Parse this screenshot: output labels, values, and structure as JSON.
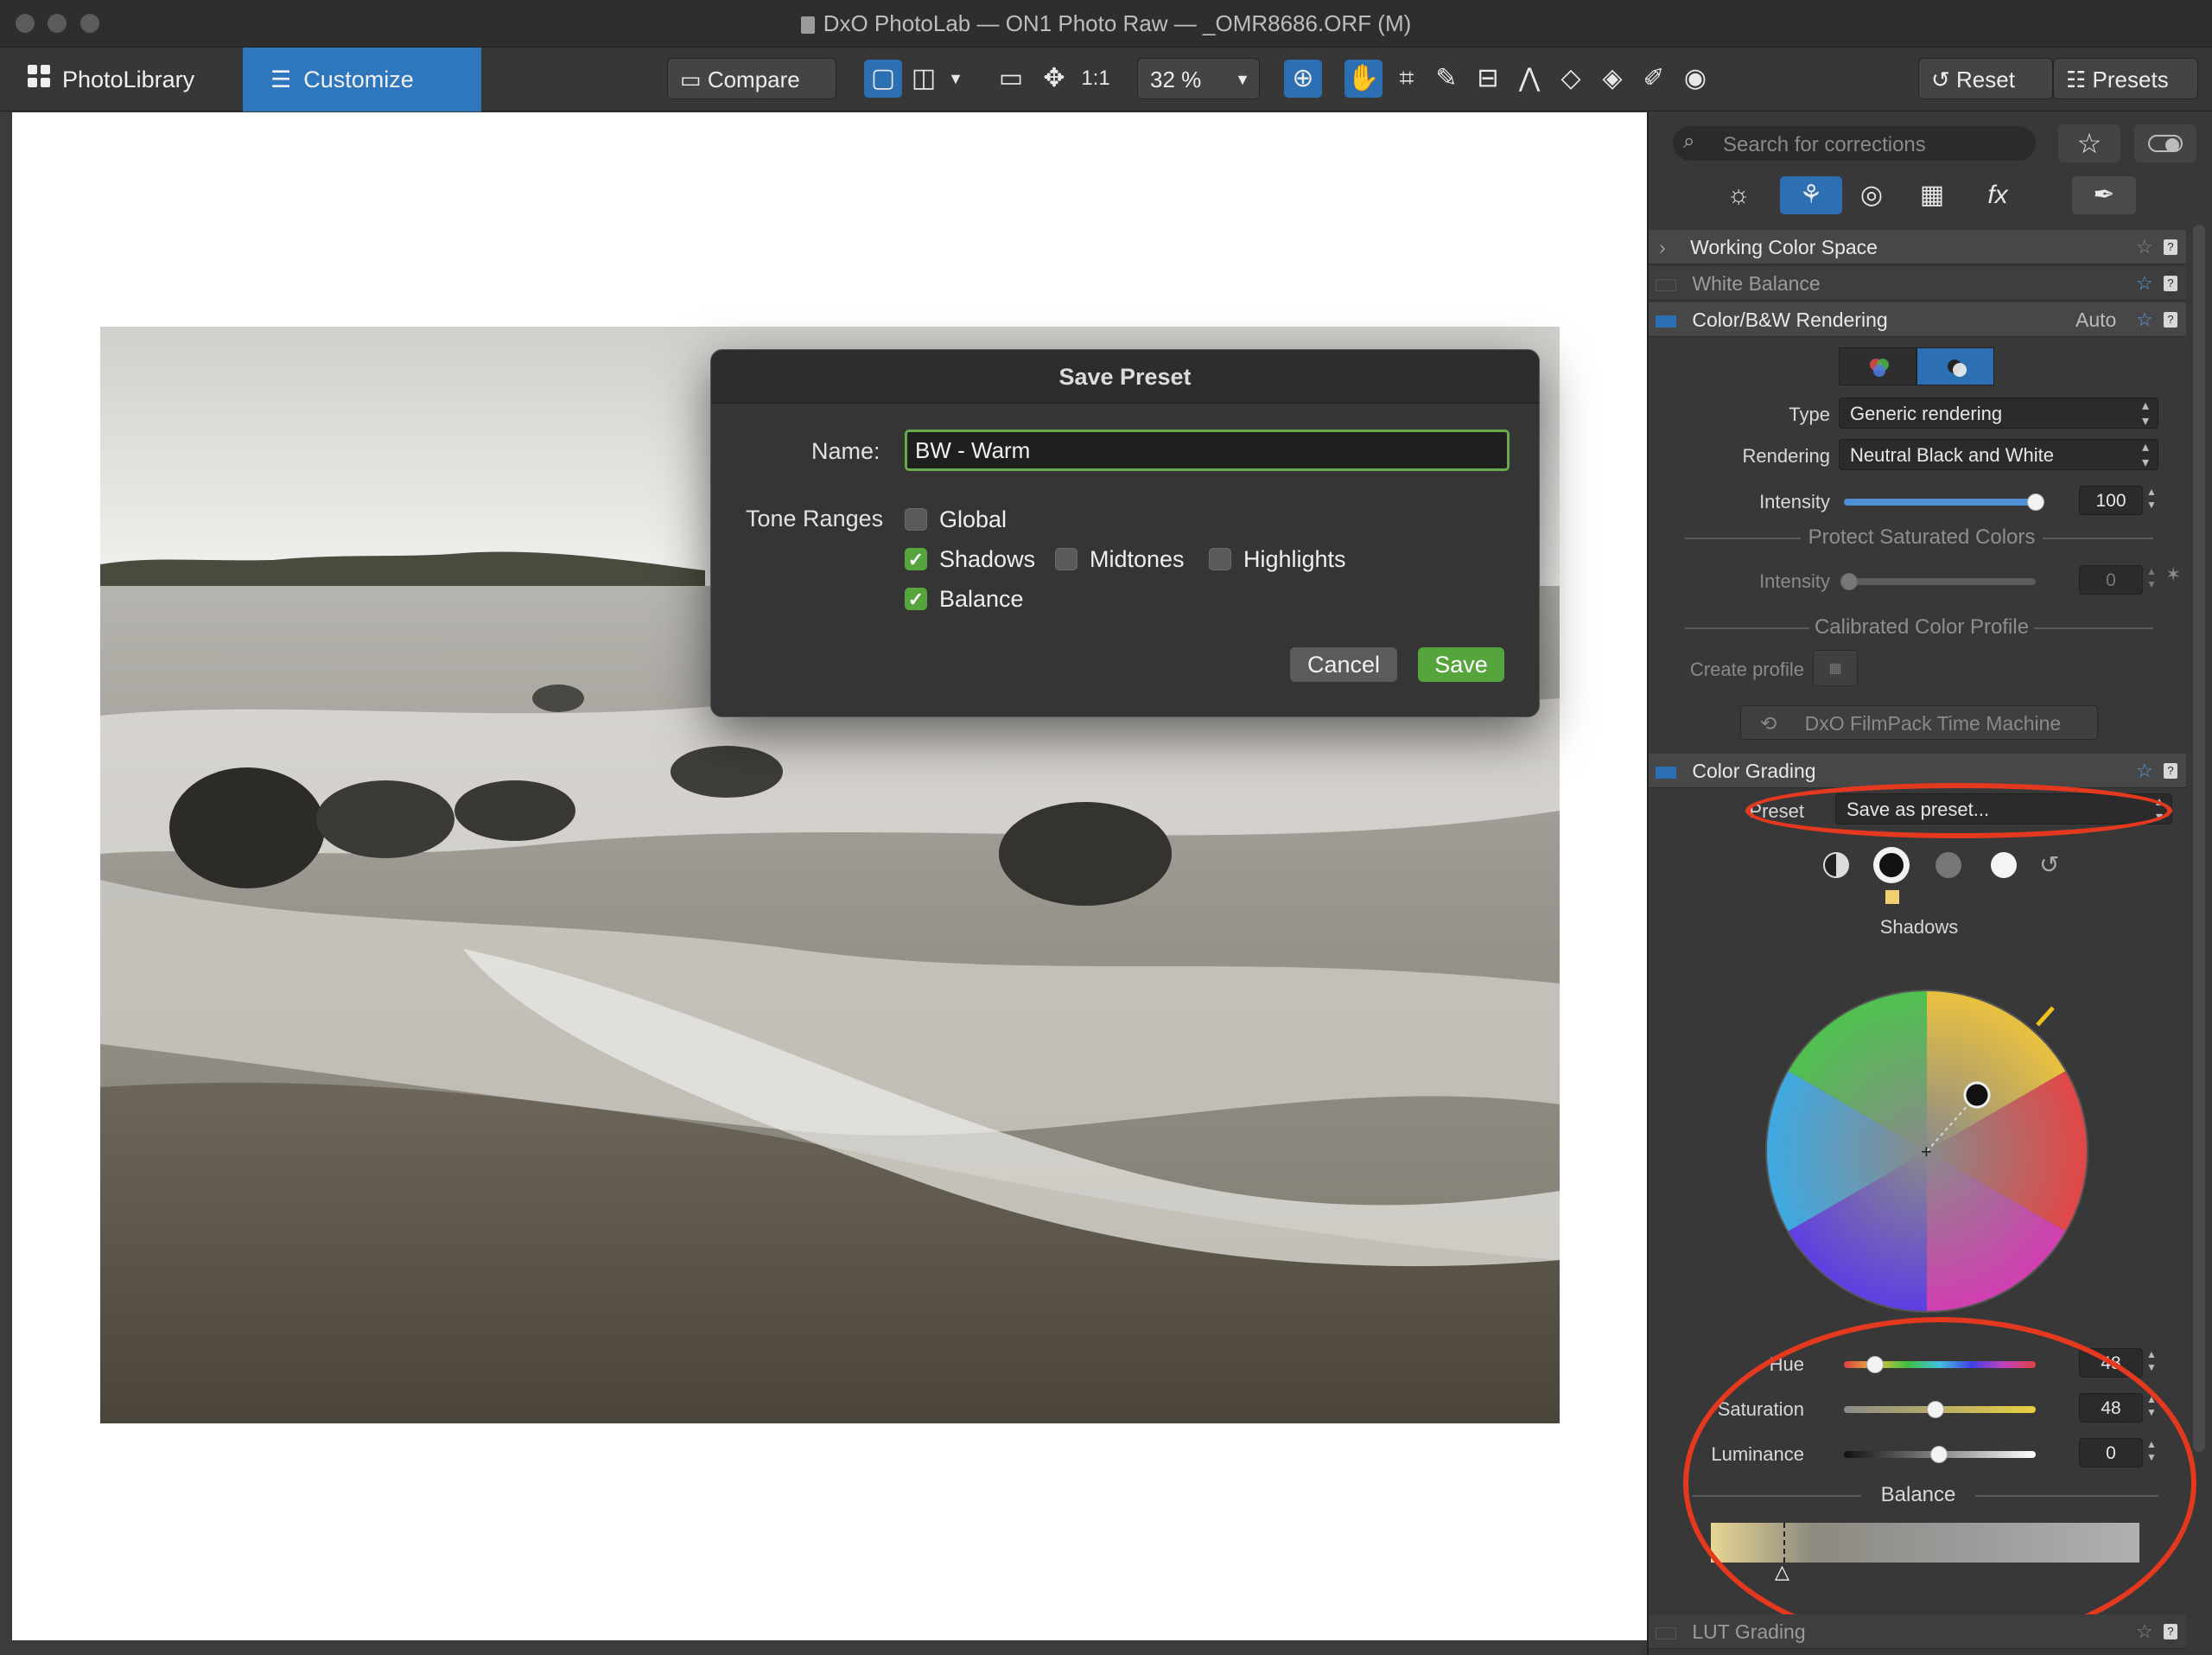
{
  "window": {
    "title": "DxO PhotoLab — ON1 Photo Raw — _OMR8686.ORF (M)"
  },
  "toolbar": {
    "photolibrary_label": "PhotoLibrary",
    "customize_label": "Customize",
    "compare_label": "Compare",
    "one_to_one": "1:1",
    "zoom": "32 %",
    "reset_label": "Reset",
    "presets_label": "Presets"
  },
  "dialog": {
    "title": "Save Preset",
    "name_label": "Name:",
    "name_value": "BW - Warm",
    "tone_ranges_label": "Tone Ranges",
    "options": {
      "global": {
        "label": "Global",
        "checked": false
      },
      "shadows": {
        "label": "Shadows",
        "checked": true
      },
      "midtones": {
        "label": "Midtones",
        "checked": false
      },
      "highlights": {
        "label": "Highlights",
        "checked": false
      },
      "balance": {
        "label": "Balance",
        "checked": true
      }
    },
    "cancel_label": "Cancel",
    "save_label": "Save"
  },
  "panel": {
    "search_placeholder": "Search for corrections",
    "sections": {
      "working_color_space": "Working Color Space",
      "white_balance": "White Balance",
      "color_bw": {
        "title": "Color/B&W Rendering",
        "mode": "Auto"
      },
      "color_grading": "Color Grading",
      "lut_grading": "LUT Grading"
    },
    "rendering": {
      "type_label": "Type",
      "type_value": "Generic rendering",
      "rendering_label": "Rendering",
      "rendering_value": "Neutral Black and White",
      "intensity_label": "Intensity",
      "intensity_value": "100",
      "intensity_fraction": 1.0,
      "protect_title": "Protect Saturated Colors",
      "protect_intensity_label": "Intensity",
      "protect_intensity_value": "0",
      "calibrated_title": "Calibrated Color Profile",
      "create_profile_label": "Create profile",
      "filmpack_label": "DxO FilmPack Time Machine"
    },
    "grading": {
      "preset_label": "Preset",
      "preset_value": "Save as preset...",
      "range_name": "Shadows",
      "hue_label": "Hue",
      "hue_value": "48",
      "saturation_label": "Saturation",
      "saturation_value": "48",
      "luminance_label": "Luminance",
      "luminance_value": "0",
      "balance_title": "Balance"
    }
  },
  "colors": {
    "accent": "#2f77bd",
    "ok_green": "#56a53c",
    "annotation": "#e5391f"
  }
}
